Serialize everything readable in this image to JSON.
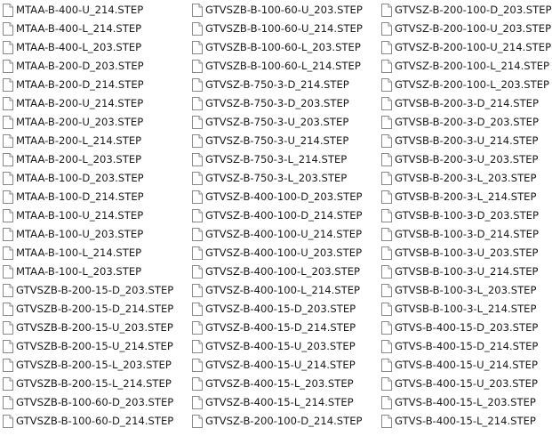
{
  "icon_name": "document-file-icon",
  "columns": [
    [
      "MTAA-B-400-U_214.STEP",
      "MTAA-B-400-L_214.STEP",
      "MTAA-B-400-L_203.STEP",
      "MTAA-B-200-D_203.STEP",
      "MTAA-B-200-D_214.STEP",
      "MTAA-B-200-U_214.STEP",
      "MTAA-B-200-U_203.STEP",
      "MTAA-B-200-L_214.STEP",
      "MTAA-B-200-L_203.STEP",
      "MTAA-B-100-D_203.STEP",
      "MTAA-B-100-D_214.STEP",
      "MTAA-B-100-U_214.STEP",
      "MTAA-B-100-U_203.STEP",
      "MTAA-B-100-L_214.STEP",
      "MTAA-B-100-L_203.STEP",
      "GTVSZB-B-200-15-D_203.STEP",
      "GTVSZB-B-200-15-D_214.STEP",
      "GTVSZB-B-200-15-U_203.STEP",
      "GTVSZB-B-200-15-U_214.STEP",
      "GTVSZB-B-200-15-L_203.STEP",
      "GTVSZB-B-200-15-L_214.STEP",
      "GTVSZB-B-100-60-D_203.STEP",
      "GTVSZB-B-100-60-D_214.STEP"
    ],
    [
      "GTVSZB-B-100-60-U_203.STEP",
      "GTVSZB-B-100-60-U_214.STEP",
      "GTVSZB-B-100-60-L_203.STEP",
      "GTVSZB-B-100-60-L_214.STEP",
      "GTVSZ-B-750-3-D_214.STEP",
      "GTVSZ-B-750-3-D_203.STEP",
      "GTVSZ-B-750-3-U_203.STEP",
      "GTVSZ-B-750-3-U_214.STEP",
      "GTVSZ-B-750-3-L_214.STEP",
      "GTVSZ-B-750-3-L_203.STEP",
      "GTVSZ-B-400-100-D_203.STEP",
      "GTVSZ-B-400-100-D_214.STEP",
      "GTVSZ-B-400-100-U_214.STEP",
      "GTVSZ-B-400-100-U_203.STEP",
      "GTVSZ-B-400-100-L_203.STEP",
      "GTVSZ-B-400-100-L_214.STEP",
      "GTVSZ-B-400-15-D_203.STEP",
      "GTVSZ-B-400-15-D_214.STEP",
      "GTVSZ-B-400-15-U_203.STEP",
      "GTVSZ-B-400-15-U_214.STEP",
      "GTVSZ-B-400-15-L_203.STEP",
      "GTVSZ-B-400-15-L_214.STEP",
      "GTVSZ-B-200-100-D_214.STEP"
    ],
    [
      "GTVSZ-B-200-100-D_203.STEP",
      "GTVSZ-B-200-100-U_203.STEP",
      "GTVSZ-B-200-100-U_214.STEP",
      "GTVSZ-B-200-100-L_214.STEP",
      "GTVSZ-B-200-100-L_203.STEP",
      "GTVSB-B-200-3-D_214.STEP",
      "GTVSB-B-200-3-D_203.STEP",
      "GTVSB-B-200-3-U_214.STEP",
      "GTVSB-B-200-3-U_203.STEP",
      "GTVSB-B-200-3-L_203.STEP",
      "GTVSB-B-200-3-L_214.STEP",
      "GTVSB-B-100-3-D_203.STEP",
      "GTVSB-B-100-3-D_214.STEP",
      "GTVSB-B-100-3-U_203.STEP",
      "GTVSB-B-100-3-U_214.STEP",
      "GTVSB-B-100-3-L_203.STEP",
      "GTVSB-B-100-3-L_214.STEP",
      "GTVS-B-400-15-D_203.STEP",
      "GTVS-B-400-15-D_214.STEP",
      "GTVS-B-400-15-U_214.STEP",
      "GTVS-B-400-15-U_203.STEP",
      "GTVS-B-400-15-L_203.STEP",
      "GTVS-B-400-15-L_214.STEP"
    ]
  ]
}
